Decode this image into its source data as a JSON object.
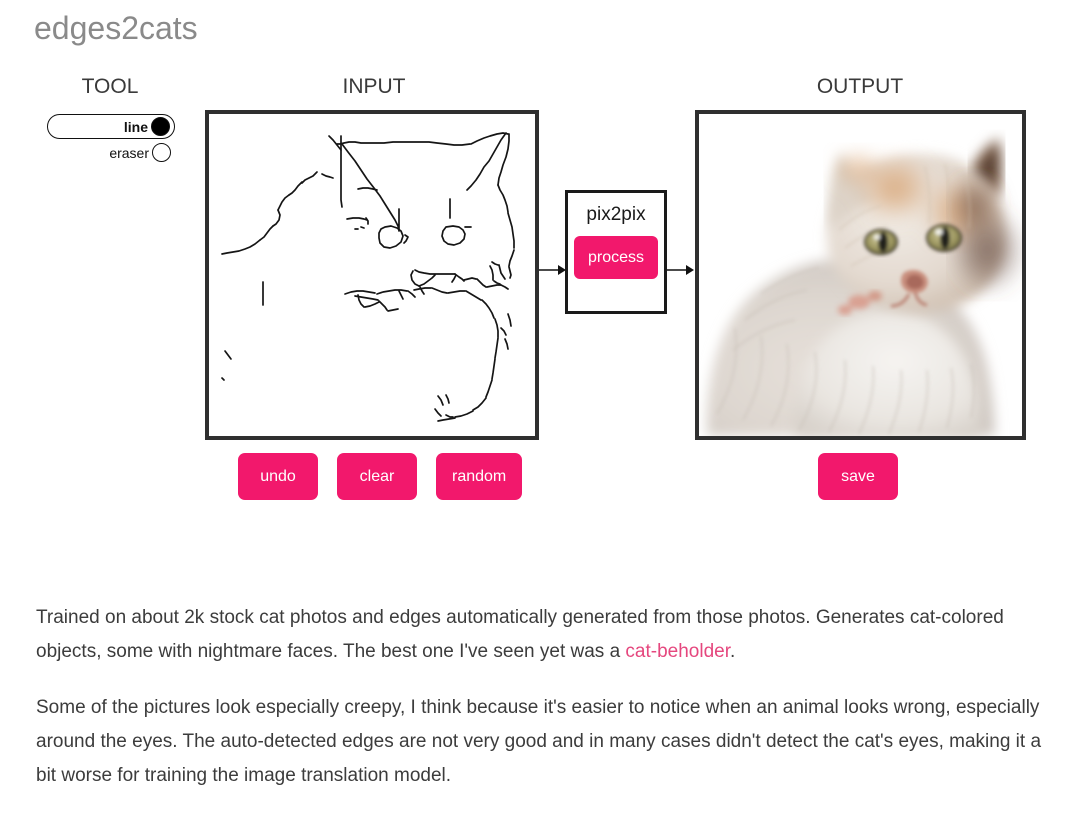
{
  "title": "edges2cats",
  "headers": {
    "tool": "TOOL",
    "input": "INPUT",
    "output": "OUTPUT"
  },
  "tool": {
    "options": [
      {
        "label": "line",
        "selected": true
      },
      {
        "label": "eraser",
        "selected": false
      }
    ]
  },
  "model": {
    "name": "pix2pix",
    "process_label": "process"
  },
  "input_actions": [
    {
      "label": "undo"
    },
    {
      "label": "clear"
    },
    {
      "label": "random"
    }
  ],
  "output_actions": [
    {
      "label": "save"
    }
  ],
  "description": {
    "paragraph1_part1": "Trained on about 2k stock cat photos and edges automatically generated from those photos. Generates cat-colored objects, some with nightmare faces. The best one I've seen yet was a ",
    "paragraph1_link": "cat-beholder",
    "paragraph1_part2": ".",
    "paragraph2": "Some of the pictures look especially creepy, I think because it's easier to notice when an animal looks wrong, especially around the eyes. The auto-detected edges are not very good and in many cases didn't detect the cat's eyes, making it a bit worse for training the image translation model."
  },
  "colors": {
    "accent_pink": "#f2186c",
    "link_pink": "#e5477e",
    "title_gray": "#8a8a8a",
    "frame_border": "#2f2f2f",
    "text": "#3c3c3c"
  },
  "canvas": {
    "input_alt": "edge-sketch-of-cat",
    "output_alt": "generated-fluffy-cat-photo"
  }
}
